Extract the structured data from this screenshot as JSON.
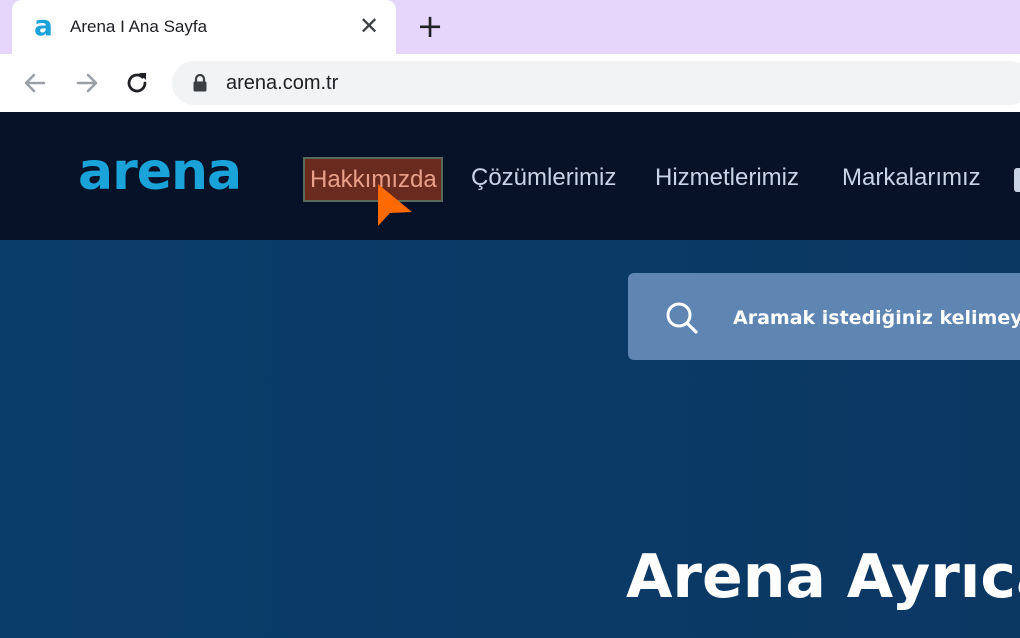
{
  "browser": {
    "tab_title": "Arena I Ana Sayfa",
    "favicon_glyph": "a",
    "close_glyph": "✕",
    "newtab_glyph": "+",
    "url": "arena.com.tr"
  },
  "site": {
    "logo_text": "arena",
    "nav": {
      "about": "Hakkımızda",
      "solutions": "Çözümlerimiz",
      "services": "Hizmetlerimiz",
      "brands": "Markalarımız"
    },
    "search": {
      "placeholder": "Aramak istediğiniz kelimeyi y"
    },
    "hero": {
      "title": "Arena Ayrıca"
    }
  },
  "colors": {
    "brand": "#1aa3d9",
    "header_bg": "#071128",
    "hero_bg": "#0b3c68",
    "cursor": "#ff6a00"
  },
  "icons": {
    "back": "arrow-left-icon",
    "forward": "arrow-right-icon",
    "reload": "reload-icon",
    "lock": "lock-icon",
    "search": "search-icon",
    "cursor": "pointer-cursor-icon"
  }
}
